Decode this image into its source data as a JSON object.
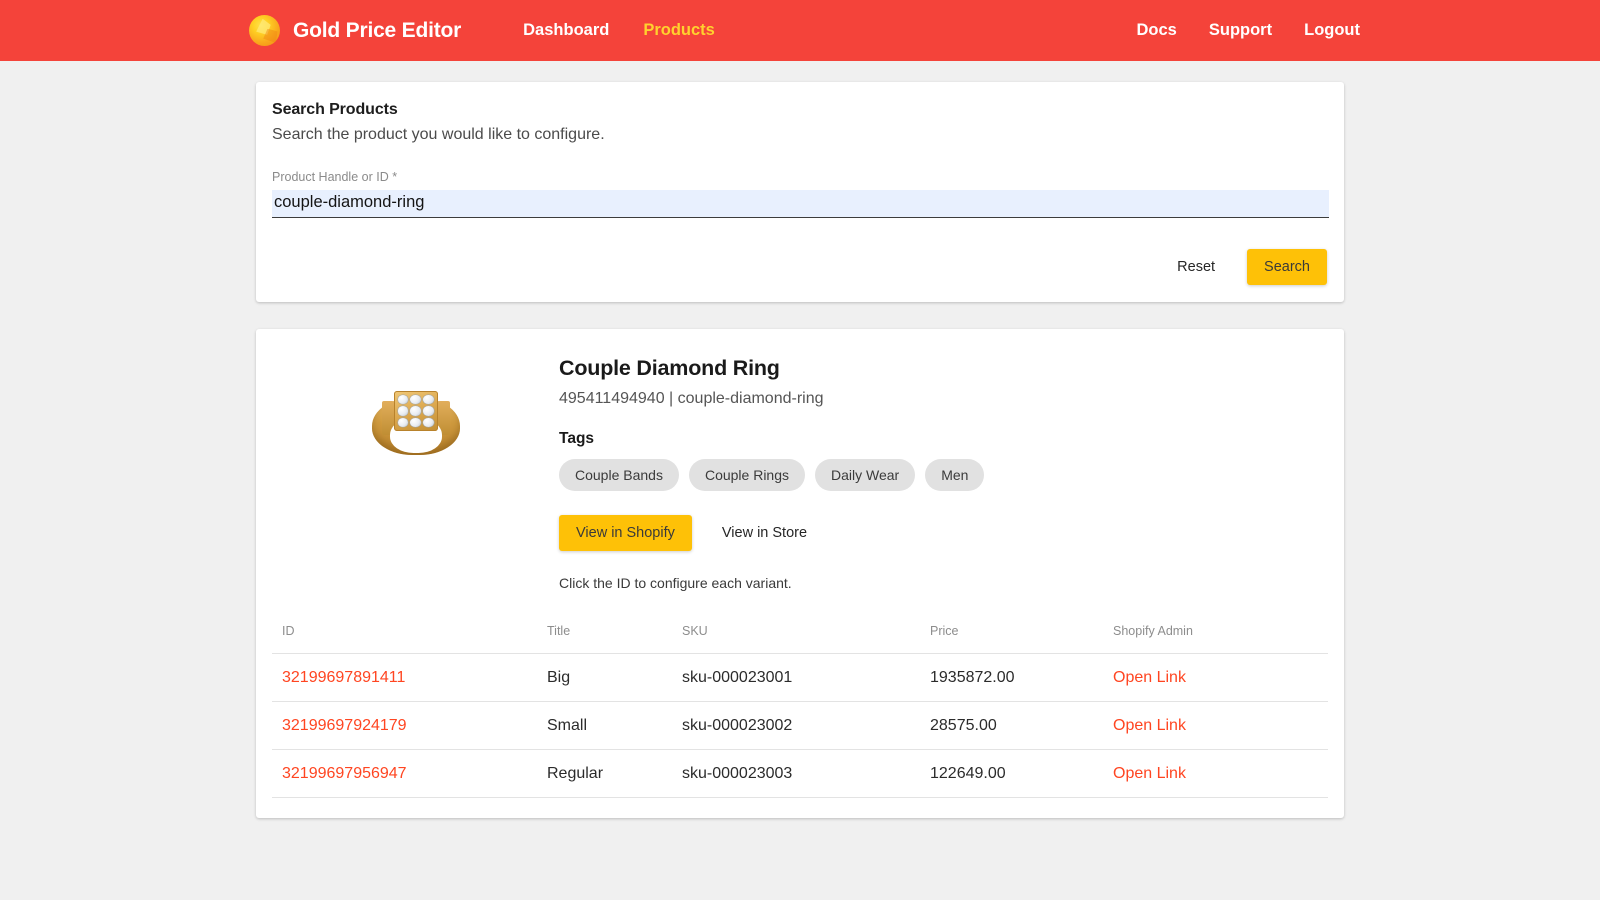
{
  "navbar": {
    "brand": "Gold Price Editor",
    "logo_icon": "gold-gem-icon",
    "left_links": [
      {
        "label": "Dashboard",
        "active": false
      },
      {
        "label": "Products",
        "active": true
      }
    ],
    "right_links": [
      {
        "label": "Docs"
      },
      {
        "label": "Support"
      },
      {
        "label": "Logout"
      }
    ],
    "background_color": "#f4433a",
    "active_link_color": "#ffd12e"
  },
  "search_card": {
    "title": "Search Products",
    "subtitle": "Search the product you would like to configure.",
    "field_label": "Product Handle or ID *",
    "field_value": "couple-diamond-ring",
    "field_placeholder": "",
    "reset_label": "Reset",
    "search_label": "Search",
    "search_button_color": "#fec107"
  },
  "product_card": {
    "image_alt": "gold-diamond-ring-thumbnail",
    "title": "Couple Diamond Ring",
    "meta": "495411494940 | couple-diamond-ring",
    "product_id": "495411494940",
    "handle": "couple-diamond-ring",
    "tags_label": "Tags",
    "tags": [
      "Couple Bands",
      "Couple Rings",
      "Daily Wear",
      "Men"
    ],
    "view_shopify_label": "View in Shopify",
    "view_store_label": "View in Store",
    "hint": "Click the ID to configure each variant.",
    "table": {
      "headers": [
        "ID",
        "Title",
        "SKU",
        "Price",
        "Shopify Admin"
      ],
      "rows": [
        {
          "id": "32199697891411",
          "title": "Big",
          "sku": "sku-000023001",
          "price": "1935872.00",
          "admin_link": "Open Link"
        },
        {
          "id": "32199697924179",
          "title": "Small",
          "sku": "sku-000023002",
          "price": "28575.00",
          "admin_link": "Open Link"
        },
        {
          "id": "32199697956947",
          "title": "Regular",
          "sku": "sku-000023003",
          "price": "122649.00",
          "admin_link": "Open Link"
        }
      ]
    },
    "link_color": "#ff4521"
  }
}
